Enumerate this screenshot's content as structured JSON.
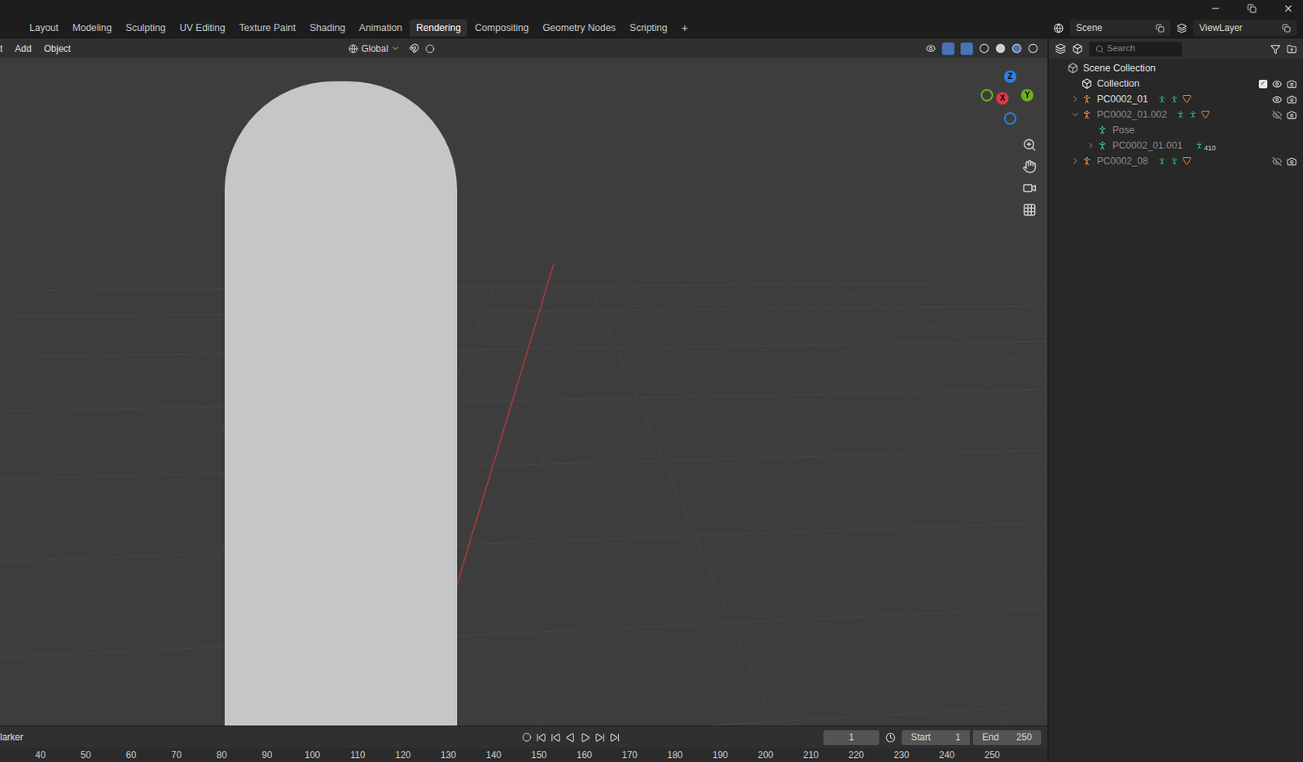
{
  "workspace_tabs": [
    {
      "label": "Layout",
      "selected": false
    },
    {
      "label": "Modeling",
      "selected": false
    },
    {
      "label": "Sculpting",
      "selected": false
    },
    {
      "label": "UV Editing",
      "selected": false
    },
    {
      "label": "Texture Paint",
      "selected": false
    },
    {
      "label": "Shading",
      "selected": false
    },
    {
      "label": "Animation",
      "selected": false
    },
    {
      "label": "Rendering",
      "selected": true
    },
    {
      "label": "Compositing",
      "selected": false
    },
    {
      "label": "Geometry Nodes",
      "selected": false
    },
    {
      "label": "Scripting",
      "selected": false
    }
  ],
  "add_tab": "+",
  "scene": "Scene",
  "view_layer": "ViewLayer",
  "viewport_header": {
    "menus": [
      "t",
      "Add",
      "Object"
    ],
    "orientation": "Global"
  },
  "gizmo": {
    "axes": [
      {
        "label": "Z",
        "color": "#2f7de1"
      },
      {
        "label": "Y",
        "color": "#6fae22"
      },
      {
        "label": "X",
        "color": "#e0364a"
      }
    ]
  },
  "outliner": {
    "search_placeholder": "Search",
    "items": [
      {
        "label": "Scene Collection",
        "kind": "scene-collection",
        "depth": 0,
        "toggle": "none",
        "dimmed": false,
        "visible": true,
        "badge": ""
      },
      {
        "label": "Collection",
        "kind": "collection",
        "depth": 1,
        "toggle": "none",
        "dimmed": false,
        "visible": true,
        "badge": ""
      },
      {
        "label": "PC0002_01",
        "kind": "armature",
        "depth": 1,
        "toggle": "collapsed",
        "dimmed": false,
        "visible": true,
        "badge": ""
      },
      {
        "label": "PC0002_01.002",
        "kind": "armature",
        "depth": 1,
        "toggle": "expanded",
        "dimmed": true,
        "visible": false,
        "badge": ""
      },
      {
        "label": "Pose",
        "kind": "pose",
        "depth": 2,
        "toggle": "none",
        "dimmed": true,
        "visible": true,
        "badge": ""
      },
      {
        "label": "PC0002_01.001",
        "kind": "pose",
        "depth": 2,
        "toggle": "collapsed",
        "dimmed": true,
        "visible": true,
        "badge": "410"
      },
      {
        "label": "PC0002_08",
        "kind": "armature",
        "depth": 1,
        "toggle": "collapsed",
        "dimmed": true,
        "visible": false,
        "badge": ""
      }
    ]
  },
  "timeline": {
    "marker": "larker",
    "frame": "1",
    "start_label": "Start",
    "start": "1",
    "end_label": "End",
    "end": "250"
  },
  "ruler": [
    "40",
    "50",
    "60",
    "70",
    "80",
    "90",
    "100",
    "110",
    "120",
    "130",
    "140",
    "150",
    "160",
    "170",
    "180",
    "190",
    "200",
    "210",
    "220",
    "230",
    "240",
    "250"
  ]
}
